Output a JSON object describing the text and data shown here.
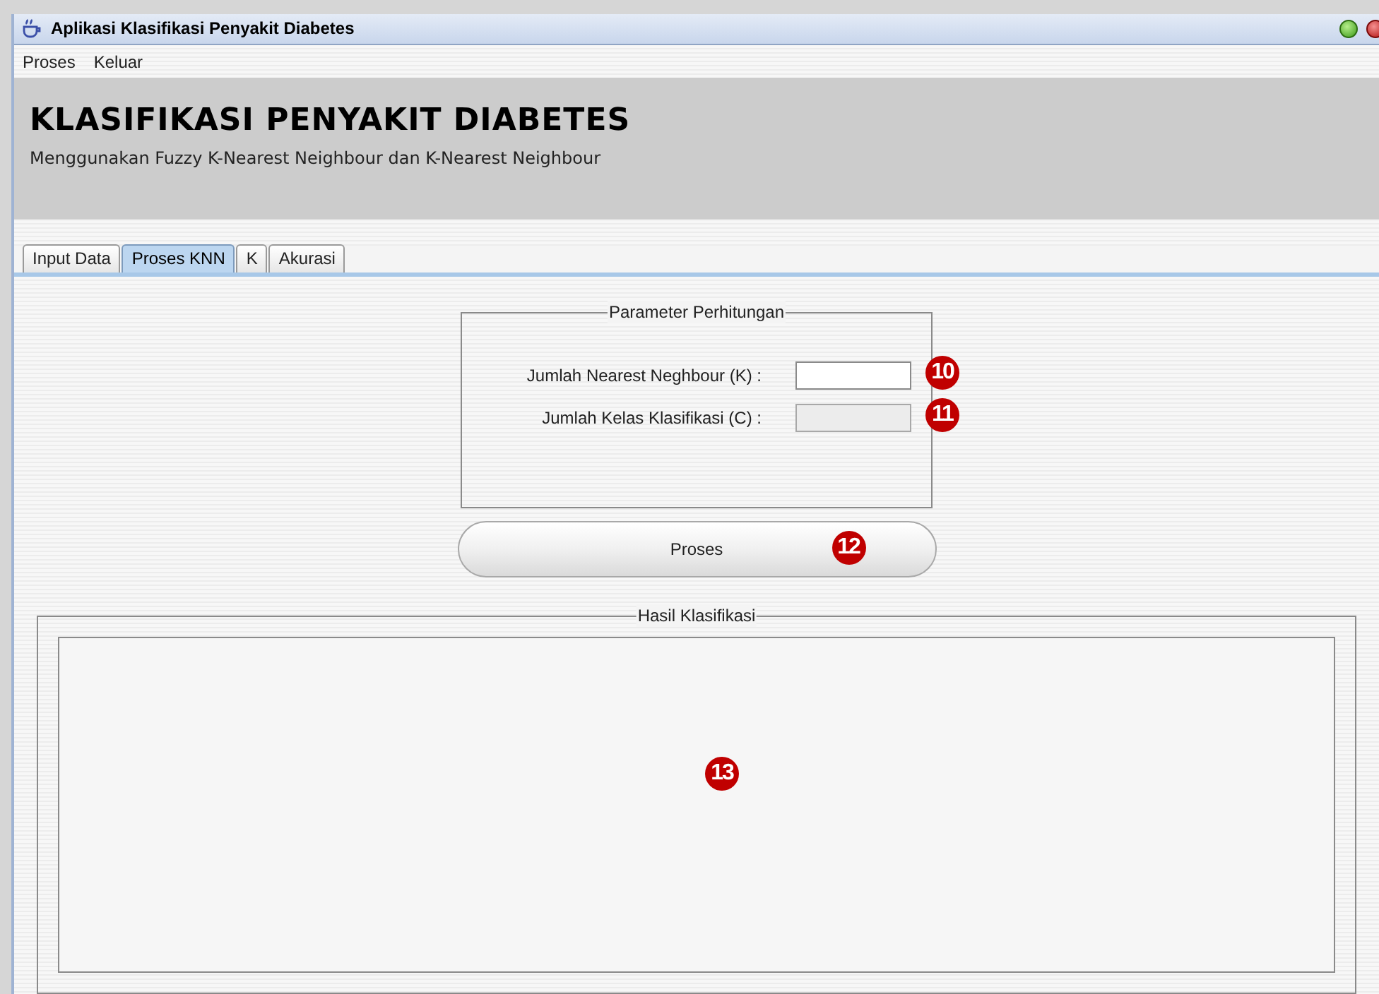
{
  "window": {
    "title": "Aplikasi Klasifikasi Penyakit Diabetes"
  },
  "menu": [
    "Proses",
    "Keluar"
  ],
  "header": {
    "title": "KLASIFIKASI PENYAKIT DIABETES",
    "subtitle": "Menggunakan Fuzzy K-Nearest Neighbour dan K-Nearest Neighbour"
  },
  "tabs": [
    {
      "label": "Input Data",
      "selected": false
    },
    {
      "label": "Proses KNN",
      "selected": true
    },
    {
      "label": "K",
      "selected": false
    },
    {
      "label": "Akurasi",
      "selected": false
    }
  ],
  "parameters": {
    "title": "Parameter Perhitungan",
    "fields": [
      {
        "label": "Jumlah Nearest Neghbour (K) :",
        "disabled": false,
        "marker": "10"
      },
      {
        "label": "Jumlah Kelas Klasifikasi (C) :",
        "disabled": true,
        "marker": "11"
      }
    ]
  },
  "process_button": {
    "label": "Proses",
    "marker": "12"
  },
  "result": {
    "title": "Hasil Klasifikasi",
    "marker": "13"
  }
}
